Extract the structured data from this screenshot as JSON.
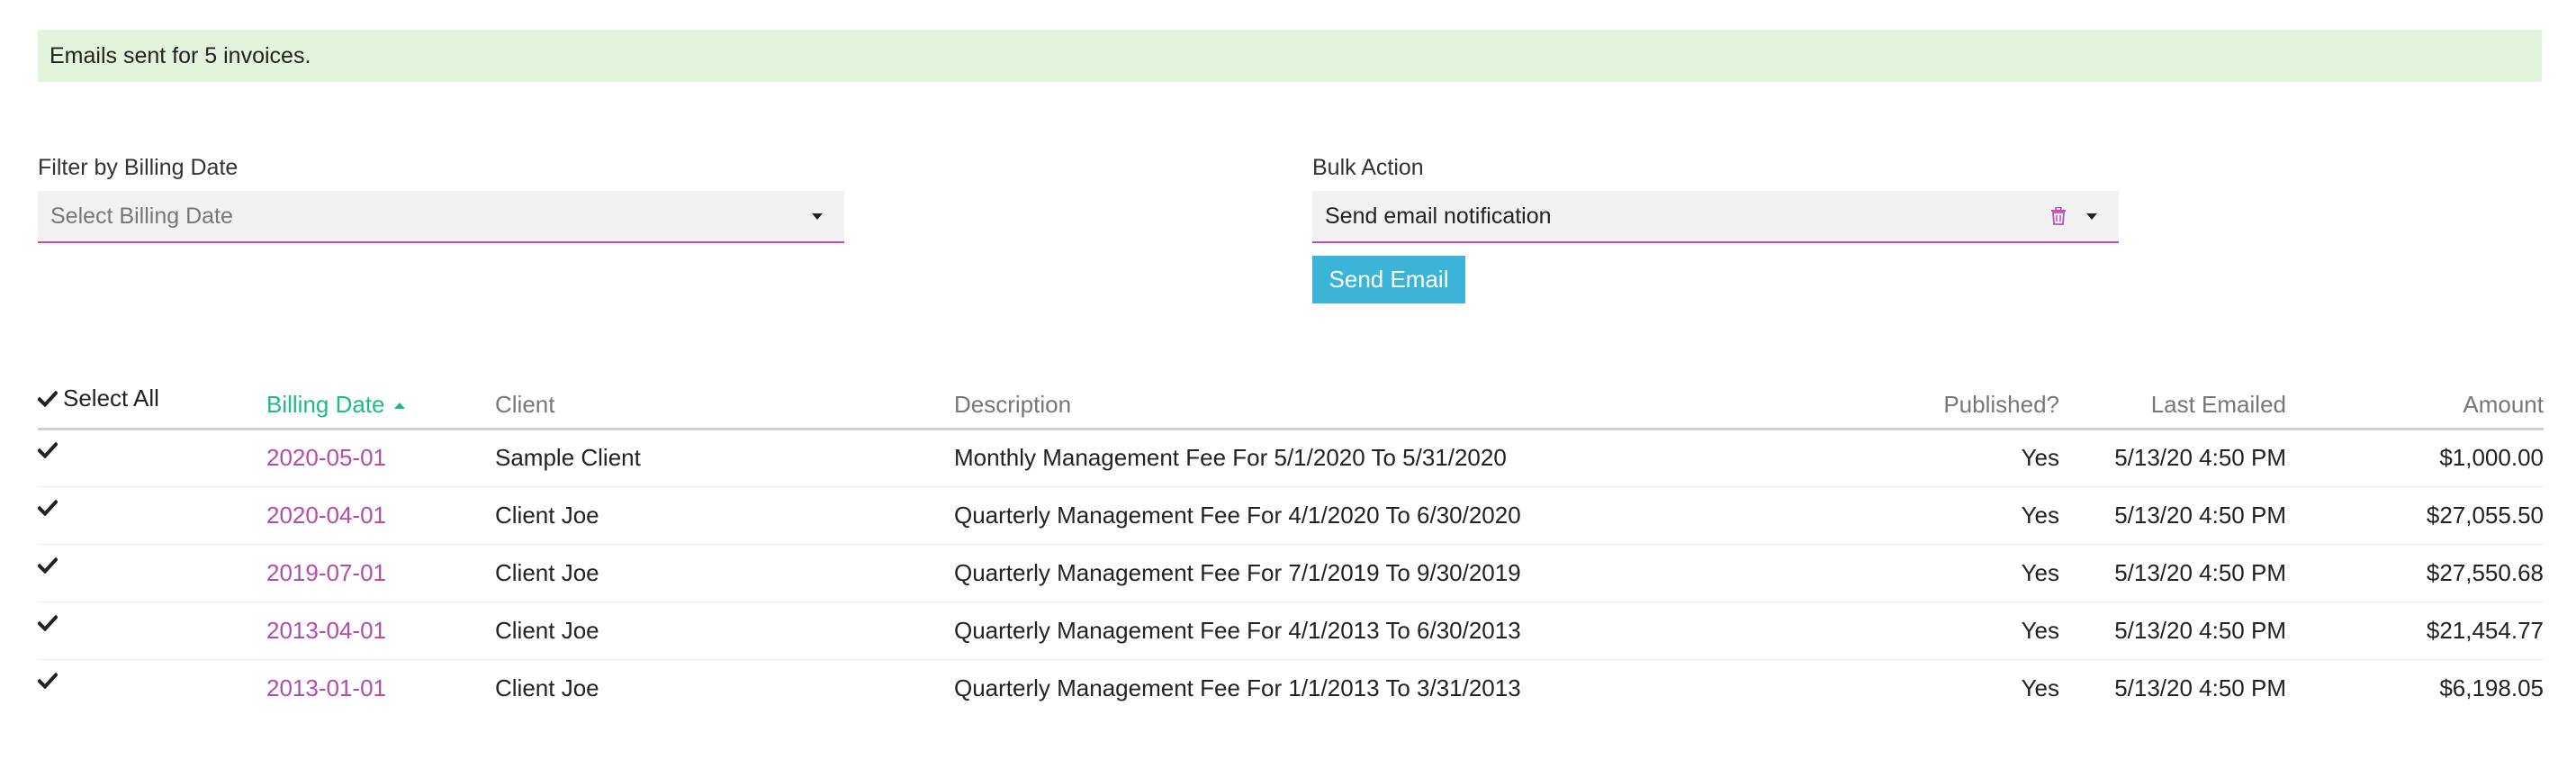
{
  "alert": {
    "message": "Emails sent for 5 invoices."
  },
  "filter": {
    "label": "Filter by Billing Date",
    "placeholder": "Select Billing Date"
  },
  "bulk_action": {
    "label": "Bulk Action",
    "value": "Send email notification",
    "button_label": "Send Email"
  },
  "colors": {
    "accent": "#c14fb6",
    "sorted": "#1fb98a",
    "button": "#3bb4d8",
    "alert_bg": "#e2f4dc"
  },
  "table": {
    "select_all_label": "Select All",
    "columns": {
      "billing_date": "Billing Date",
      "client": "Client",
      "description": "Description",
      "published": "Published?",
      "last_emailed": "Last Emailed",
      "amount": "Amount"
    },
    "sort": {
      "column": "billing_date",
      "direction": "ascending",
      "icon": "sort-up-icon"
    },
    "rows": [
      {
        "billing_date": "2020-05-01",
        "client": "Sample Client",
        "description": "Monthly Management Fee For 5/1/2020 To 5/31/2020",
        "published": "Yes",
        "last_emailed": "5/13/20 4:50 PM",
        "amount": "$1,000.00"
      },
      {
        "billing_date": "2020-04-01",
        "client": "Client Joe",
        "description": "Quarterly Management Fee For 4/1/2020 To 6/30/2020",
        "published": "Yes",
        "last_emailed": "5/13/20 4:50 PM",
        "amount": "$27,055.50"
      },
      {
        "billing_date": "2019-07-01",
        "client": "Client Joe",
        "description": "Quarterly Management Fee For 7/1/2019 To 9/30/2019",
        "published": "Yes",
        "last_emailed": "5/13/20 4:50 PM",
        "amount": "$27,550.68"
      },
      {
        "billing_date": "2013-04-01",
        "client": "Client Joe",
        "description": "Quarterly Management Fee For 4/1/2013 To 6/30/2013",
        "published": "Yes",
        "last_emailed": "5/13/20 4:50 PM",
        "amount": "$21,454.77"
      },
      {
        "billing_date": "2013-01-01",
        "client": "Client Joe",
        "description": "Quarterly Management Fee For 1/1/2013 To 3/31/2013",
        "published": "Yes",
        "last_emailed": "5/13/20 4:50 PM",
        "amount": "$6,198.05"
      }
    ]
  }
}
